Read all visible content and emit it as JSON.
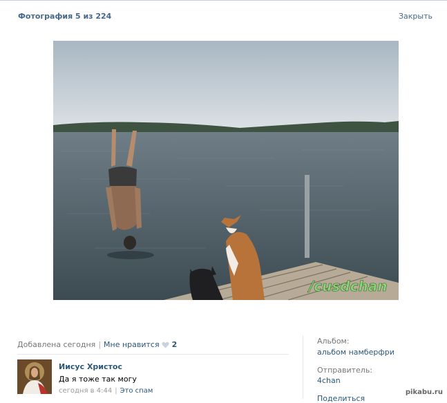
{
  "header": {
    "title": "Фотография 5 из 224",
    "close_label": "Закрыть"
  },
  "photo": {
    "watermark": "/cusdchan"
  },
  "info": {
    "added": "Добавлена сегодня",
    "like_label": "Мне нравится",
    "like_count": "2"
  },
  "comment": {
    "author": "Иисус Христос",
    "text": "Да я тоже так могу",
    "time": "сегодня в 4:44",
    "spam_label": "Это спам"
  },
  "sidebar": {
    "album_label": "Альбом:",
    "album_value": "альбом намберфри",
    "sender_label": "Отправитель:",
    "sender_value": "4chan",
    "share_label": "Поделиться"
  },
  "site_watermark": "pikabu.ru",
  "colors": {
    "link": "#2b587a",
    "title": "#45688e",
    "muted": "#777777"
  }
}
